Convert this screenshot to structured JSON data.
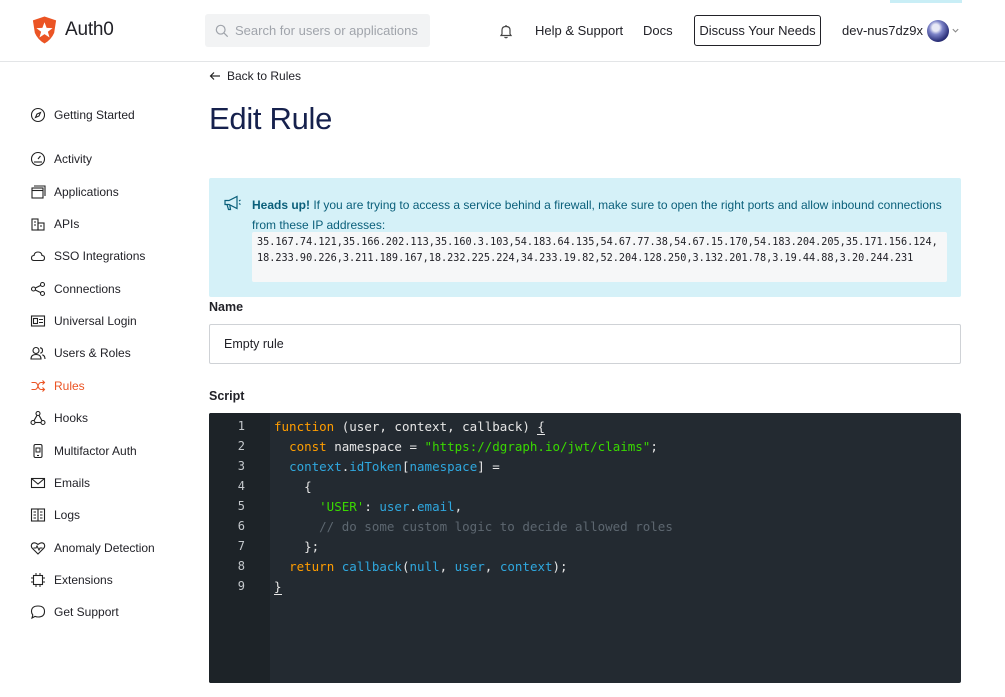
{
  "header": {
    "brand": "Auth0",
    "search_placeholder": "Search for users or applications",
    "help_label": "Help & Support",
    "docs_label": "Docs",
    "discuss_label": "Discuss Your Needs",
    "tenant_name": "dev-nus7dz9x"
  },
  "sidebar": {
    "items": [
      {
        "label": "Getting Started"
      },
      {
        "label": "Activity"
      },
      {
        "label": "Applications"
      },
      {
        "label": "APIs"
      },
      {
        "label": "SSO Integrations"
      },
      {
        "label": "Connections"
      },
      {
        "label": "Universal Login"
      },
      {
        "label": "Users & Roles"
      },
      {
        "label": "Rules",
        "active": true
      },
      {
        "label": "Hooks"
      },
      {
        "label": "Multifactor Auth"
      },
      {
        "label": "Emails"
      },
      {
        "label": "Logs"
      },
      {
        "label": "Anomaly Detection"
      },
      {
        "label": "Extensions"
      },
      {
        "label": "Get Support"
      }
    ]
  },
  "main": {
    "back_label": "Back to Rules",
    "title": "Edit Rule",
    "alert": {
      "strong": "Heads up!",
      "text": " If you are trying to access a service behind a firewall, make sure to open the right ports and allow inbound connections from these IP addresses:",
      "ips": "35.167.74.121,35.166.202.113,35.160.3.103,54.183.64.135,54.67.77.38,54.67.15.170,54.183.204.205,35.171.156.124,18.233.90.226,3.211.189.167,18.232.225.224,34.233.19.82,52.204.128.250,3.132.201.78,3.19.44.88,3.20.244.231"
    },
    "name_label": "Name",
    "name_value": "Empty rule",
    "script_label": "Script",
    "line_numbers": [
      "1",
      "2",
      "3",
      "4",
      "5",
      "6",
      "7",
      "8",
      "9"
    ],
    "code": {
      "l1_kw": "function",
      "l1_rest": " (user, context, callback) ",
      "l1_brace": "{",
      "l2_indent": "  ",
      "l2_kw": "const",
      "l2_mid": " namespace = ",
      "l2_str": "\"https://dgraph.io/jwt/claims\"",
      "l2_end": ";",
      "l3_indent": "  ",
      "l3_obj": "context",
      "l3_dot": ".",
      "l3_prop": "idToken",
      "l3_open": "[",
      "l3_var": "namespace",
      "l3_close": "] =",
      "l4_text": "    {",
      "l5_indent": "      ",
      "l5_str": "'USER'",
      "l5_colon": ": ",
      "l5_obj": "user",
      "l5_dot": ".",
      "l5_prop": "email",
      "l5_end": ",",
      "l6_indent": "      ",
      "l6_comment": "// do some custom logic to decide allowed roles",
      "l7_text": "    };",
      "l8_indent": "  ",
      "l8_kw": "return",
      "l8_sp": " ",
      "l8_fn": "callback",
      "l8_open": "(",
      "l8_null": "null",
      "l8_c1": ", ",
      "l8_user": "user",
      "l8_c2": ", ",
      "l8_ctx": "context",
      "l8_end": ");",
      "l9_text": "}"
    }
  }
}
